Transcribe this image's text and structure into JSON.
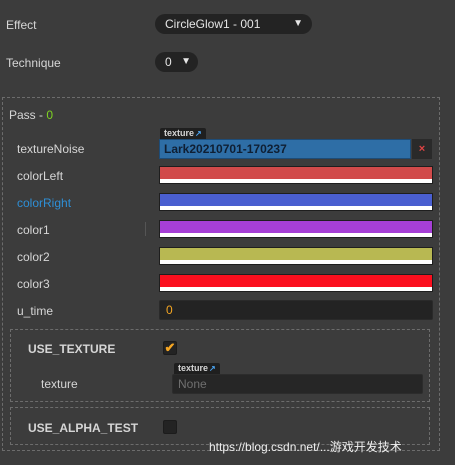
{
  "effect": {
    "label": "Effect",
    "value": "CircleGlow1 - 001"
  },
  "technique": {
    "label": "Technique",
    "value": "0"
  },
  "pass": {
    "label": "Pass - ",
    "index": "0"
  },
  "props": {
    "texture_noise": {
      "label": "textureNoise",
      "tag": "texture",
      "value": "Lark20210701-170237",
      "clear": "×"
    },
    "color_left": {
      "label": "colorLeft",
      "color": "#d14a4a"
    },
    "color_right": {
      "label": "colorRight",
      "color": "#4a5fd1"
    },
    "color1": {
      "label": "color1",
      "color": "#a63fd6"
    },
    "color2": {
      "label": "color2",
      "color": "#b8b852"
    },
    "color3": {
      "label": "color3",
      "color": "#fb0f1e"
    },
    "u_time": {
      "label": "u_time",
      "value": "0"
    }
  },
  "defines": {
    "use_texture": {
      "label": "USE_TEXTURE",
      "checked": true,
      "texture_label": "texture",
      "texture_tag": "texture",
      "texture_value": "None"
    },
    "use_alpha_test": {
      "label": "USE_ALPHA_TEST",
      "checked": false
    }
  },
  "watermark": "https://blog.csdn.net/...游戏开发技术"
}
